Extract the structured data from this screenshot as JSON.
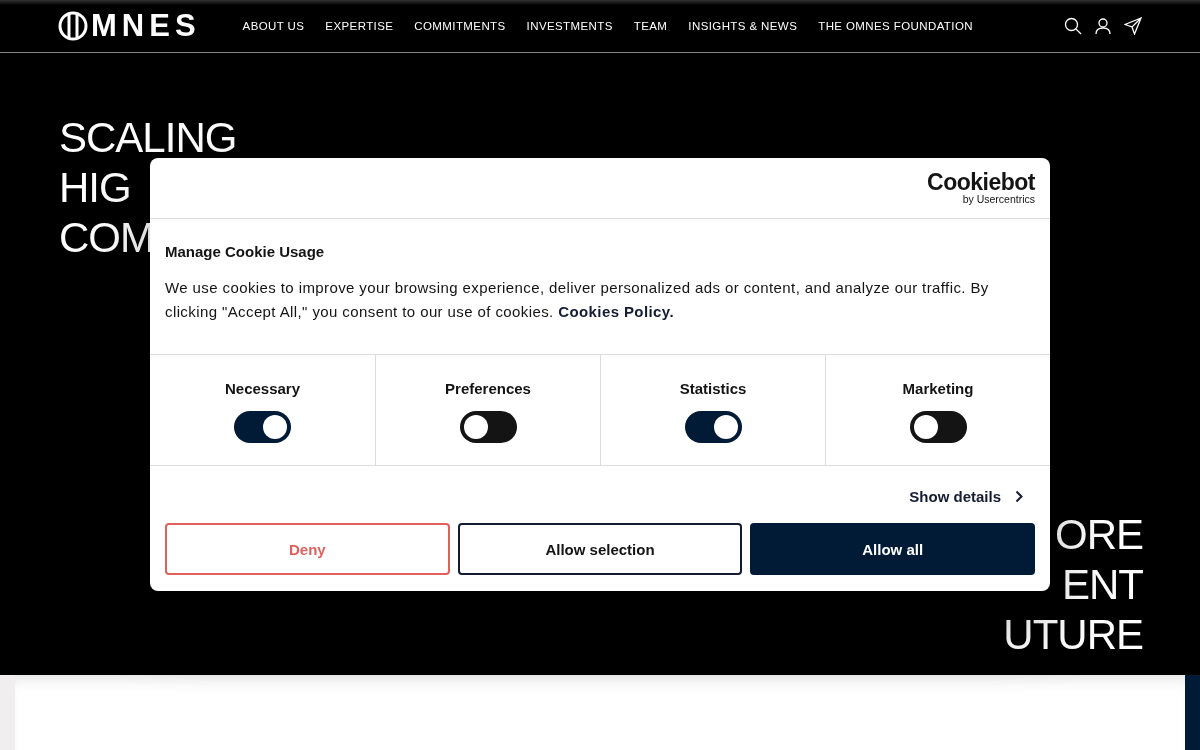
{
  "header": {
    "logo": "MNES",
    "nav": [
      {
        "label": "ABOUT US"
      },
      {
        "label": "EXPERTISE"
      },
      {
        "label": "COMMITMENTS"
      },
      {
        "label": "INVESTMENTS"
      },
      {
        "label": "TEAM"
      },
      {
        "label": "INSIGHTS & NEWS"
      },
      {
        "label": "THE OMNES FOUNDATION"
      }
    ]
  },
  "hero": {
    "left_lines": [
      "SCALING",
      "HIG",
      "COM"
    ],
    "right_lines": [
      "ORE",
      "ENT",
      "UTURE"
    ]
  },
  "cookie_dialog": {
    "brand": "Cookiebot",
    "brand_sub": "by Usercentrics",
    "title": "Manage Cookie Usage",
    "text": "We use cookies to improve your browsing experience, deliver personalized ads or content, and analyze our traffic. By clicking \"Accept All,\" you consent to our use of cookies.",
    "policy_link": "Cookies Policy.",
    "categories": [
      {
        "label": "Necessary",
        "on": true
      },
      {
        "label": "Preferences",
        "on": false
      },
      {
        "label": "Statistics",
        "on": true
      },
      {
        "label": "Marketing",
        "on": false
      }
    ],
    "details_link": "Show details",
    "buttons": [
      {
        "label": "Deny",
        "kind": "deny"
      },
      {
        "label": "Allow selection",
        "kind": "outline"
      },
      {
        "label": "Allow all",
        "kind": "primary"
      }
    ]
  }
}
